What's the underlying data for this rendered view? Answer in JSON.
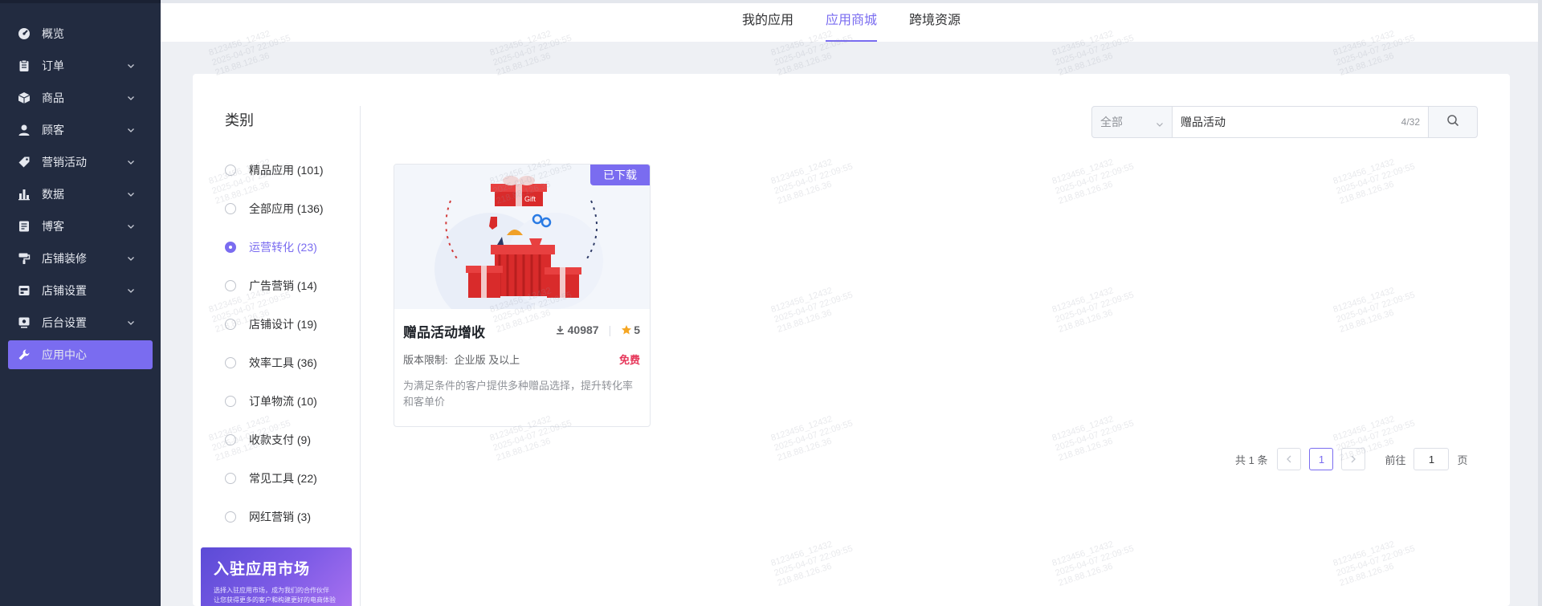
{
  "sidebar": {
    "items": [
      {
        "label": "概览",
        "icon": "gauge-icon",
        "has_children": false
      },
      {
        "label": "订单",
        "icon": "clipboard-icon",
        "has_children": true
      },
      {
        "label": "商品",
        "icon": "box-icon",
        "has_children": true
      },
      {
        "label": "顾客",
        "icon": "user-icon",
        "has_children": true
      },
      {
        "label": "营销活动",
        "icon": "tag-icon",
        "has_children": true
      },
      {
        "label": "数据",
        "icon": "bar-chart-icon",
        "has_children": true
      },
      {
        "label": "博客",
        "icon": "document-icon",
        "has_children": true
      },
      {
        "label": "店铺装修",
        "icon": "paint-roller-icon",
        "has_children": true
      },
      {
        "label": "店铺设置",
        "icon": "store-settings-icon",
        "has_children": true
      },
      {
        "label": "后台设置",
        "icon": "monitor-settings-icon",
        "has_children": true
      },
      {
        "label": "应用中心",
        "icon": "wrench-icon",
        "has_children": false,
        "active": true
      }
    ]
  },
  "tabs": [
    {
      "label": "我的应用",
      "active": false
    },
    {
      "label": "应用商城",
      "active": true
    },
    {
      "label": "跨境资源",
      "active": false
    }
  ],
  "category": {
    "title": "类别",
    "items": [
      {
        "label": "精品应用 (101)",
        "selected": false
      },
      {
        "label": "全部应用 (136)",
        "selected": false
      },
      {
        "label": "运营转化 (23)",
        "selected": true
      },
      {
        "label": "广告营销 (14)",
        "selected": false
      },
      {
        "label": "店铺设计 (19)",
        "selected": false
      },
      {
        "label": "效率工具 (36)",
        "selected": false
      },
      {
        "label": "订单物流 (10)",
        "selected": false
      },
      {
        "label": "收款支付 (9)",
        "selected": false
      },
      {
        "label": "常见工具 (22)",
        "selected": false
      },
      {
        "label": "网红营销 (3)",
        "selected": false
      }
    ]
  },
  "banner": {
    "title": "入驻应用市场",
    "desc_line1": "选择入驻应用市场，成为我们的合作伙伴",
    "desc_line2": "让您获得更多的客户和构建更好的电商体验"
  },
  "search": {
    "scope": "全部",
    "value": "赠品活动",
    "char_count": "4/32"
  },
  "app": {
    "badge": "已下载",
    "name": "赠品活动增收",
    "downloads": "40987",
    "rating": "5",
    "version_label": "版本限制:",
    "version_value": "企业版 及以上",
    "price": "免费",
    "description": "为满足条件的客户提供多种赠品选择，提升转化率和客单价",
    "gift_tag": "Gift"
  },
  "pagination": {
    "total": "共 1 条",
    "current": "1",
    "goto_label": "前往",
    "goto_value": "1",
    "page_suffix": "页"
  },
  "watermark": {
    "line1": "8123456_12432",
    "line2": "2025-04-07 22:09:55",
    "line3": "218.88.126.36"
  },
  "colors": {
    "sidebar_bg": "#222b40",
    "accent": "#7a6cf0",
    "price_red": "#e6375a",
    "star_orange": "#f5a623"
  }
}
